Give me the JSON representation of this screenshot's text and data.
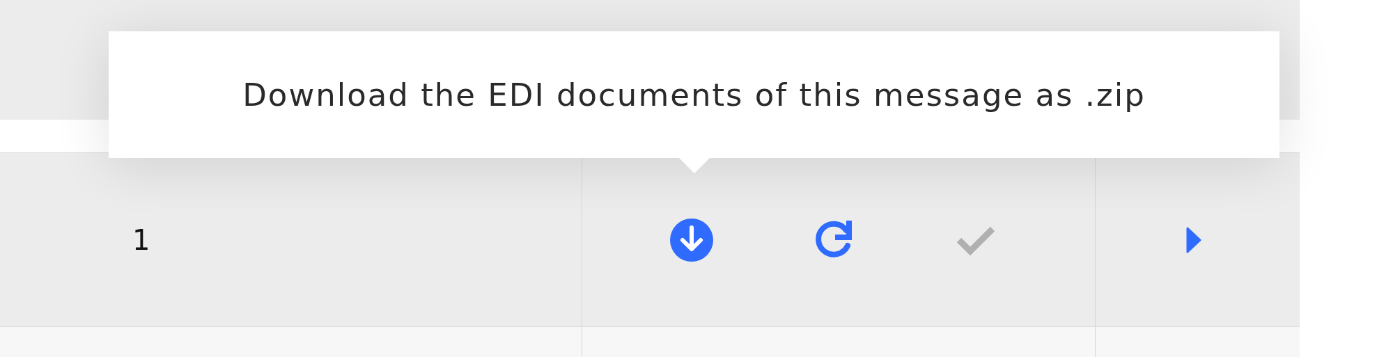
{
  "table": {
    "rows": [
      {
        "column_1": "1",
        "actions": [
          {
            "kind": "download",
            "disabled": false
          },
          {
            "kind": "retry",
            "disabled": false
          },
          {
            "kind": "confirm",
            "disabled": true
          }
        ],
        "expand": true
      }
    ]
  },
  "tooltip": {
    "text": "Download the EDI documents of this message as .zip"
  }
}
